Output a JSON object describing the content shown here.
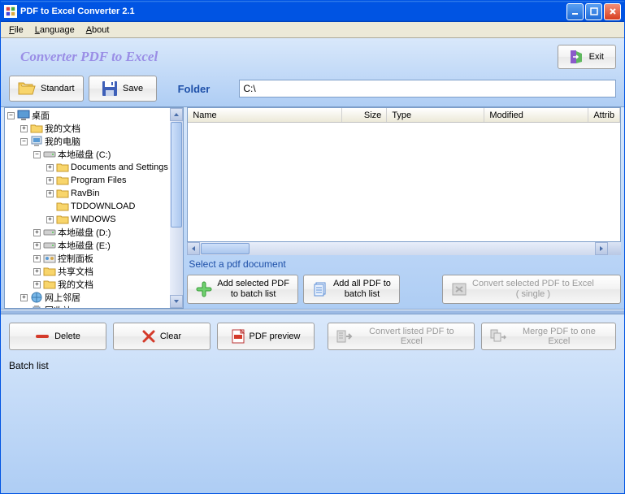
{
  "window": {
    "title": "PDF to Excel Converter 2.1"
  },
  "menu": {
    "file": "File",
    "language": "Language",
    "about": "About"
  },
  "header": {
    "app_title": "Converter PDF to Excel",
    "exit": "Exit"
  },
  "toolbar": {
    "standart": "Standart",
    "save": "Save",
    "folder_label": "Folder",
    "folder_value": "C:\\"
  },
  "tree": {
    "root": "桌面",
    "items": [
      {
        "depth": 0,
        "exp": "-",
        "icon": "desktop",
        "label": "桌面"
      },
      {
        "depth": 1,
        "exp": "+",
        "icon": "folder",
        "label": "我的文档"
      },
      {
        "depth": 1,
        "exp": "-",
        "icon": "computer",
        "label": "我的电脑"
      },
      {
        "depth": 2,
        "exp": "-",
        "icon": "drive",
        "label": "本地磁盘 (C:)"
      },
      {
        "depth": 3,
        "exp": "+",
        "icon": "folder",
        "label": "Documents and Settings"
      },
      {
        "depth": 3,
        "exp": "+",
        "icon": "folder",
        "label": "Program Files"
      },
      {
        "depth": 3,
        "exp": "+",
        "icon": "folder",
        "label": "RavBin"
      },
      {
        "depth": 3,
        "exp": "",
        "icon": "folder",
        "label": "TDDOWNLOAD"
      },
      {
        "depth": 3,
        "exp": "+",
        "icon": "folder",
        "label": "WINDOWS"
      },
      {
        "depth": 2,
        "exp": "+",
        "icon": "drive",
        "label": "本地磁盘 (D:)"
      },
      {
        "depth": 2,
        "exp": "+",
        "icon": "drive",
        "label": "本地磁盘 (E:)"
      },
      {
        "depth": 2,
        "exp": "+",
        "icon": "control",
        "label": "控制面板"
      },
      {
        "depth": 2,
        "exp": "+",
        "icon": "folder",
        "label": "共享文档"
      },
      {
        "depth": 2,
        "exp": "+",
        "icon": "folder",
        "label": "我的文档"
      },
      {
        "depth": 1,
        "exp": "+",
        "icon": "network",
        "label": "网上邻居"
      },
      {
        "depth": 1,
        "exp": "",
        "icon": "recycle",
        "label": "回收站"
      }
    ]
  },
  "filelist": {
    "col_name": "Name",
    "col_size": "Size",
    "col_type": "Type",
    "col_modified": "Modified",
    "col_attrib": "Attrib"
  },
  "labels": {
    "select_pdf": "Select a pdf document",
    "batch_list": "Batch list"
  },
  "actions": {
    "add_selected_l1": "Add selected PDF",
    "add_selected_l2": "to batch list",
    "add_all_l1": "Add all PDF to",
    "add_all_l2": "batch list",
    "convert_selected_l1": "Convert selected PDF to Excel",
    "convert_selected_l2": "( single )"
  },
  "bottom": {
    "delete": "Delete",
    "clear": "Clear",
    "preview": "PDF preview",
    "convert_listed": "Convert listed PDF to Excel",
    "merge": "Merge PDF to one Excel"
  }
}
